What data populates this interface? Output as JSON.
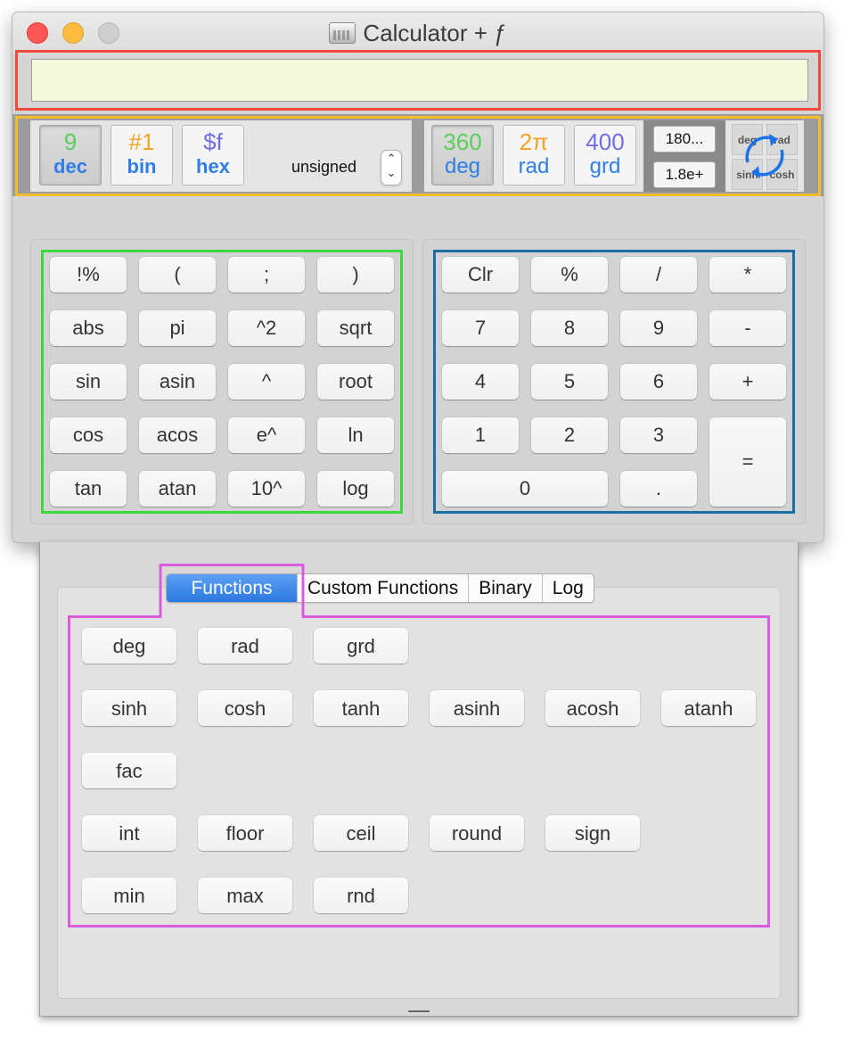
{
  "window": {
    "title": "Calculator + ƒ",
    "traffic_lights": [
      "close",
      "minimize",
      "zoom"
    ]
  },
  "display": {
    "value": ""
  },
  "base_modes": [
    {
      "top": "9",
      "bottom": "dec",
      "top_color": "#5bce5a",
      "selected": true
    },
    {
      "top": "#1",
      "bottom": "bin",
      "top_color": "#f4a424",
      "selected": false
    },
    {
      "top": "$f",
      "bottom": "hex",
      "top_color": "#6e6ee6",
      "selected": false
    }
  ],
  "sign_mode": {
    "label": "unsigned",
    "stepper_icon": "up-down-chevron-icon"
  },
  "angle_modes": [
    {
      "top": "360",
      "bottom": "deg",
      "top_color": "#5bce5a",
      "selected": true
    },
    {
      "top": "2π",
      "bottom": "rad",
      "top_color": "#f4a424",
      "selected": false
    },
    {
      "top": "400",
      "bottom": "grd",
      "top_color": "#6e6ee6",
      "selected": false
    }
  ],
  "number_format": {
    "fixed_label": "180...",
    "scientific_label": "1.8e+"
  },
  "conversion_grid": {
    "cells": [
      "deg",
      "rad",
      "sinh",
      "cosh"
    ],
    "icon": "rotate-arrows-icon"
  },
  "scientific_keys": [
    [
      "!%",
      "(",
      ";",
      ")"
    ],
    [
      "abs",
      "pi",
      "^2",
      "sqrt"
    ],
    [
      "sin",
      "asin",
      "^",
      "root"
    ],
    [
      "cos",
      "acos",
      "e^",
      "ln"
    ],
    [
      "tan",
      "atan",
      "10^",
      "log"
    ]
  ],
  "numeric_keys": {
    "row1": [
      "Clr",
      "%",
      "/",
      "*"
    ],
    "row2": [
      "7",
      "8",
      "9",
      "-"
    ],
    "row3": [
      "4",
      "5",
      "6",
      "+"
    ],
    "row4": [
      "1",
      "2",
      "3"
    ],
    "row5": [
      "0",
      "."
    ],
    "equals": "="
  },
  "drawer": {
    "tabs": [
      {
        "label": "Functions",
        "active": true
      },
      {
        "label": "Custom Functions",
        "active": false
      },
      {
        "label": "Binary",
        "active": false
      },
      {
        "label": "Log",
        "active": false
      }
    ],
    "function_rows": [
      [
        "deg",
        "rad",
        "grd"
      ],
      [
        "sinh",
        "cosh",
        "tanh",
        "asinh",
        "acosh",
        "atanh"
      ],
      [
        "fac"
      ],
      [
        "int",
        "floor",
        "ceil",
        "round",
        "sign"
      ],
      [
        "min",
        "max",
        "rnd"
      ]
    ]
  },
  "annotation_colors": {
    "display": "#f1493a",
    "modes": "#f2bc2a",
    "scientific": "#3bd840",
    "numeric": "#1b6ea8",
    "functions": "#d95ce0"
  }
}
